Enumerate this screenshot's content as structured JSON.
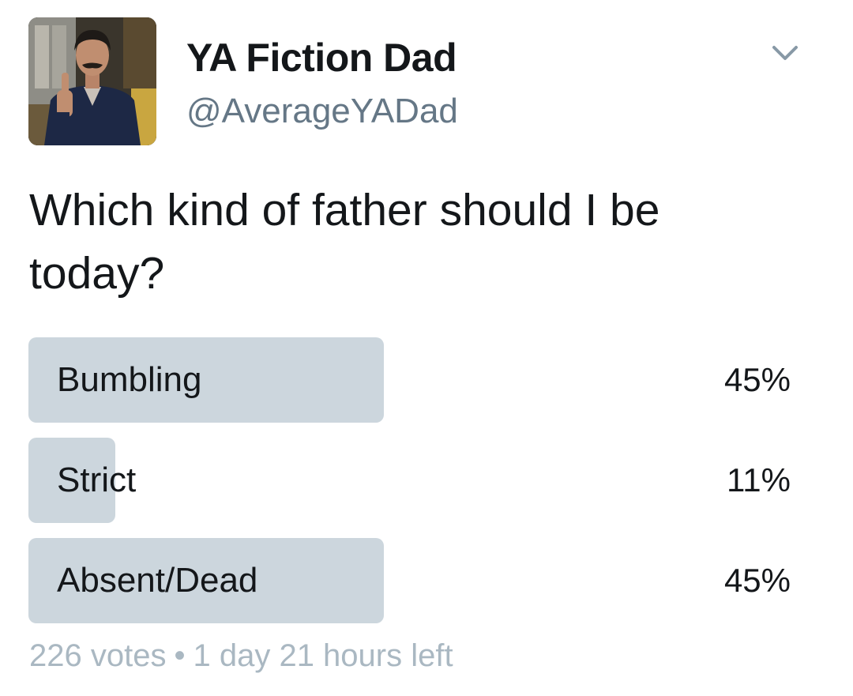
{
  "user": {
    "display_name": "YA Fiction Dad",
    "handle": "@AverageYADad",
    "avatar": "profile-photo"
  },
  "menu_icon": "chevron-down-icon",
  "tweet": {
    "text": "Which kind of father should I be today?"
  },
  "poll": {
    "options": [
      {
        "label": "Bumbling",
        "percent_text": "45%",
        "fraction": 0.45
      },
      {
        "label": "Strict",
        "percent_text": "11%",
        "fraction": 0.11
      },
      {
        "label": "Absent/Dead",
        "percent_text": "45%",
        "fraction": 0.45
      }
    ],
    "votes": "226 votes",
    "separator": "•",
    "time_left": "1 day 21 hours left"
  },
  "colors": {
    "bar": "#ccd6dd",
    "handle": "#657786",
    "meta": "#aab8c2",
    "text": "#14171a"
  }
}
